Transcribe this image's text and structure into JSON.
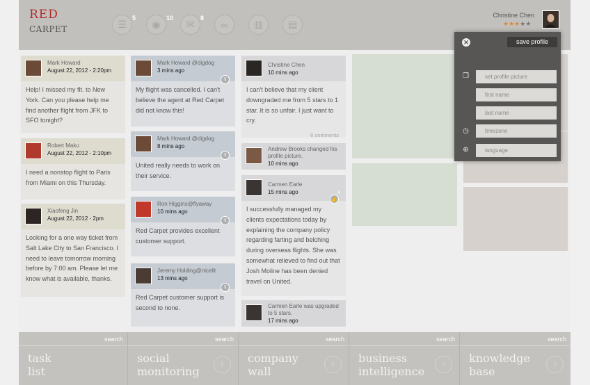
{
  "logo": {
    "line1": "RED",
    "line2": "CARPET"
  },
  "nav": [
    {
      "icon": "tasks-icon",
      "glyph": "☰",
      "badge": "5"
    },
    {
      "icon": "user-icon",
      "glyph": "👤",
      "badge": "10"
    },
    {
      "icon": "chat-icon",
      "glyph": "💬",
      "badge": "8"
    },
    {
      "icon": "infinity-icon",
      "glyph": "∞",
      "badge": ""
    },
    {
      "icon": "chart-icon",
      "glyph": "▥",
      "badge": ""
    },
    {
      "icon": "folder-icon",
      "glyph": "▤",
      "badge": ""
    }
  ],
  "user": {
    "name": "Christine Chen",
    "rating": 3,
    "max_rating": 5
  },
  "columns": {
    "tasks": [
      {
        "name": "Mark Howard",
        "date": "August 22, 2012 - 2:20pm",
        "body": "Help! I missed my flt. to New York. Can you please help me find another flight from JFK to SFO tonight?"
      },
      {
        "name": "Robert Maku",
        "date": "August 22, 2012 - 2:10pm",
        "body": "I need a nonstop flight to Paris from Miami on this Thursday."
      },
      {
        "name": "Xiaofeng Jin",
        "date": "August 22, 2012 - 2pm",
        "body": "Looking for a one way ticket from Salt Lake City to San Francisco. I need to leave tomorrow morning before by 7:00 am. Please let me know what is available, thanks."
      }
    ],
    "social": [
      {
        "name": "Mark Howard @digdog",
        "date": "3 mins ago",
        "body": "My flight was cancelled. I can't believe the agent at Red Carpet did not know this!"
      },
      {
        "name": "Mark Howard @digdog",
        "date": "8 mins ago",
        "body": "United really needs to work on their service."
      },
      {
        "name": "Ron Higgins@flyaway",
        "date": "10 mins ago",
        "body": "Red Carpet provides excellent customer support."
      },
      {
        "name": "Jeremy Holding@nicelit",
        "date": "13 mins ago",
        "body": "Red Carpet customer support is second to none."
      }
    ],
    "wall": [
      {
        "name": "Christine Chen",
        "date": "10 mins ago",
        "body": "I can't believe that my client downgraded me from 5 stars to 1 star. It is so unfair. I just want to cry.",
        "meta": "6 comments"
      },
      {
        "name": "Andrew Brooks changed his profile picture.",
        "date": "10 mins ago",
        "body": ""
      },
      {
        "name": "Carmen Earle",
        "date": "15 mins ago",
        "body": "I successfully managed my clients expectations today by explaining the company policy regarding farting and belching during overseas flights. She was somewhat relieved to find out that Josh Moline has been denied travel on United.",
        "meta": "4"
      },
      {
        "name": "Carmen Earle was upgraded to 5 stars.",
        "date": "17 mins ago",
        "body": ""
      }
    ]
  },
  "popup": {
    "save_label": "save profile",
    "fields": [
      "set profile picture",
      "first name",
      "last name",
      "timezone",
      "language"
    ]
  },
  "bottom": [
    {
      "label": "task\nlist",
      "search": "search",
      "has_up": false
    },
    {
      "label": "social\nmonitoring",
      "search": "search",
      "has_up": true
    },
    {
      "label": "company\nwall",
      "search": "search",
      "has_up": true
    },
    {
      "label": "business\nintelligence",
      "search": "search",
      "has_up": true
    },
    {
      "label": "knowledge\nbase",
      "search": "search",
      "has_up": true
    }
  ],
  "colors": {
    "task_head": "#dedbcf",
    "social_head": "#c4cbd3",
    "wall_head": "#d7d7d9",
    "bi_tile": "#d6ddd2",
    "kb_tile": "#d6d1cd"
  }
}
